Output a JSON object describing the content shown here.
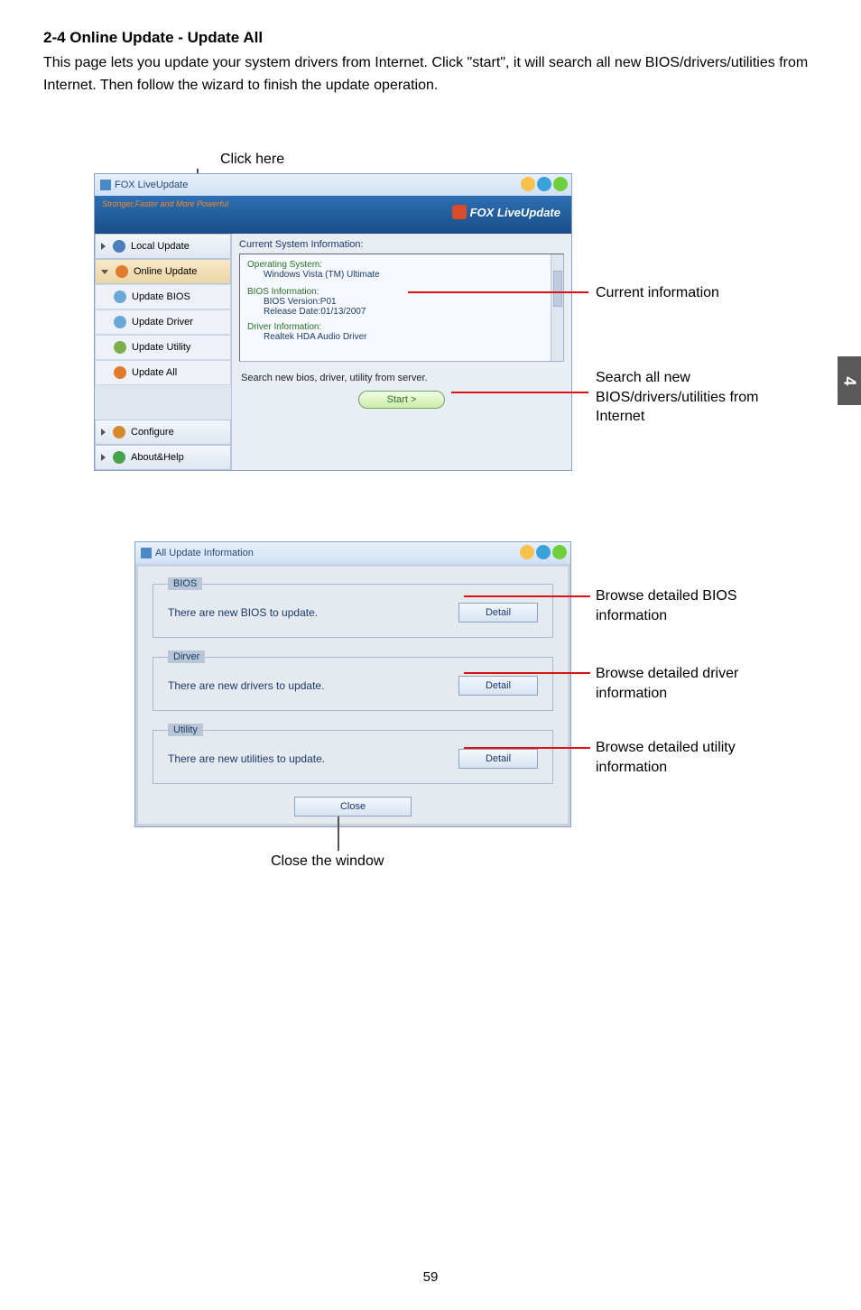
{
  "heading": "2-4 Online Update - Update All",
  "body": "This page lets you update your system drivers from Internet. Click \"start\", it will search all new BIOS/drivers/utilities from Internet. Then follow the wizard to finish the update operation.",
  "click_here": "Click here",
  "page_tab": "4",
  "page_num": "59",
  "shot1": {
    "title": "FOX LiveUpdate",
    "slogan": "Stronger,Faster and More Powerful",
    "brand": "FOX LiveUpdate",
    "sidebar": {
      "local": "Local Update",
      "online": "Online Update",
      "ubios": "Update BIOS",
      "udrv": "Update Driver",
      "uutil": "Update Utility",
      "uall": "Update All",
      "config": "Configure",
      "about": "About&Help"
    },
    "main_label": "Current System Information:",
    "info": {
      "os_h": "Operating System:",
      "os_v": "Windows Vista (TM) Ultimate",
      "bi_h": "BIOS Information:",
      "bi_v1": "BIOS Version:P01",
      "bi_v2": "Release Date:01/13/2007",
      "dr_h": "Driver Information:",
      "dr_v": "Realtek HDA Audio Driver"
    },
    "search_line": "Search new bios, driver, utility from server.",
    "start": "Start  >"
  },
  "ann1": {
    "current": "Current information",
    "search": "Search all new BIOS/drivers/utilities from Internet"
  },
  "shot2": {
    "title": "All Update Information",
    "bios_legend": "BIOS",
    "bios_text": "There are new BIOS to update.",
    "drv_legend": "Dirver",
    "drv_text": "There are new drivers to update.",
    "util_legend": "Utility",
    "util_text": "There are new utilities to update.",
    "detail": "Detail",
    "close": "Close"
  },
  "ann2": {
    "bios": "Browse detailed BIOS information",
    "drv": "Browse detailed driver information",
    "util": "Browse detailed utility information"
  },
  "close_window": "Close the window"
}
